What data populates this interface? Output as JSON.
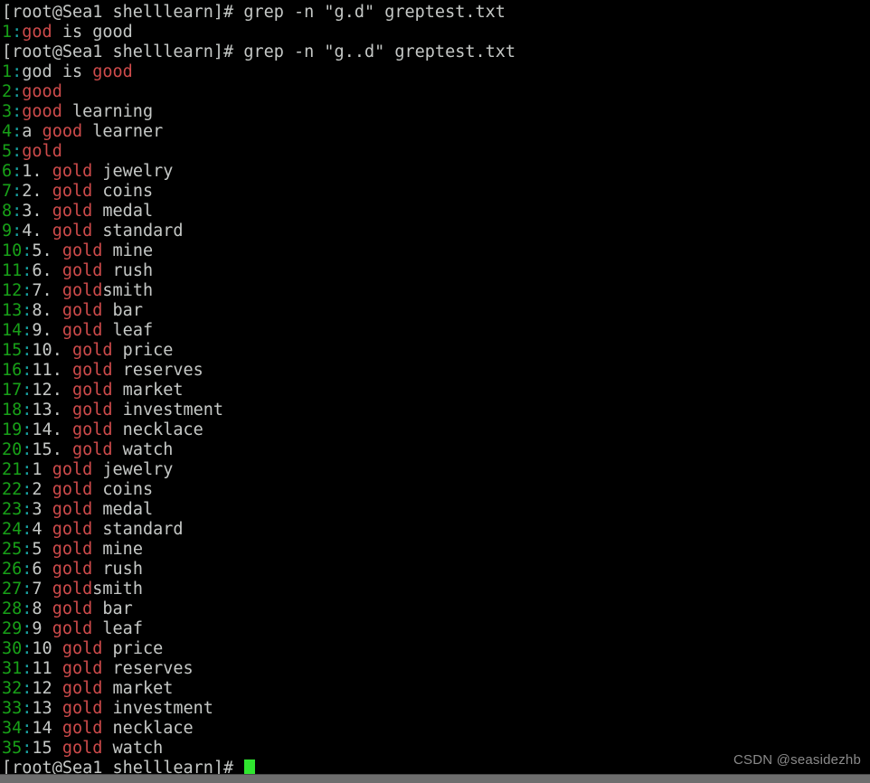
{
  "terminal": {
    "shell_prompt": "[root@Sea1 shelllearn]# ",
    "colors": {
      "background": "#000000",
      "foreground": "#c5c8c6",
      "line_number": "#18a018",
      "separator": "#18a0a0",
      "match": "#cf4b4b",
      "cursor": "#2fe62f",
      "watermark": "#8a8a8a",
      "bottom_bar": "#6e6e6e"
    },
    "commands": [
      {
        "text": "grep -n \"g.d\" greptest.txt"
      },
      {
        "text": "grep -n \"g..d\" greptest.txt"
      }
    ],
    "lines": [
      {
        "type": "command",
        "prompt": "[root@Sea1 shelllearn]# ",
        "command": "grep -n \"g.d\" greptest.txt"
      },
      {
        "type": "result",
        "lineno": "1",
        "sep": ":",
        "parts": [
          {
            "t": "god",
            "m": true
          },
          {
            "t": " is good",
            "m": false
          }
        ]
      },
      {
        "type": "command",
        "prompt": "[root@Sea1 shelllearn]# ",
        "command": "grep -n \"g..d\" greptest.txt"
      },
      {
        "type": "result",
        "lineno": "1",
        "sep": ":",
        "parts": [
          {
            "t": "god is ",
            "m": false
          },
          {
            "t": "good",
            "m": true
          }
        ]
      },
      {
        "type": "result",
        "lineno": "2",
        "sep": ":",
        "parts": [
          {
            "t": "good",
            "m": true
          }
        ]
      },
      {
        "type": "result",
        "lineno": "3",
        "sep": ":",
        "parts": [
          {
            "t": "good",
            "m": true
          },
          {
            "t": " learning",
            "m": false
          }
        ]
      },
      {
        "type": "result",
        "lineno": "4",
        "sep": ":",
        "parts": [
          {
            "t": "a ",
            "m": false
          },
          {
            "t": "good",
            "m": true
          },
          {
            "t": " learner",
            "m": false
          }
        ]
      },
      {
        "type": "result",
        "lineno": "5",
        "sep": ":",
        "parts": [
          {
            "t": "gold",
            "m": true
          }
        ]
      },
      {
        "type": "result",
        "lineno": "6",
        "sep": ":",
        "parts": [
          {
            "t": "1. ",
            "m": false
          },
          {
            "t": "gold",
            "m": true
          },
          {
            "t": " jewelry",
            "m": false
          }
        ]
      },
      {
        "type": "result",
        "lineno": "7",
        "sep": ":",
        "parts": [
          {
            "t": "2. ",
            "m": false
          },
          {
            "t": "gold",
            "m": true
          },
          {
            "t": " coins",
            "m": false
          }
        ]
      },
      {
        "type": "result",
        "lineno": "8",
        "sep": ":",
        "parts": [
          {
            "t": "3. ",
            "m": false
          },
          {
            "t": "gold",
            "m": true
          },
          {
            "t": " medal",
            "m": false
          }
        ]
      },
      {
        "type": "result",
        "lineno": "9",
        "sep": ":",
        "parts": [
          {
            "t": "4. ",
            "m": false
          },
          {
            "t": "gold",
            "m": true
          },
          {
            "t": " standard",
            "m": false
          }
        ]
      },
      {
        "type": "result",
        "lineno": "10",
        "sep": ":",
        "parts": [
          {
            "t": "5. ",
            "m": false
          },
          {
            "t": "gold",
            "m": true
          },
          {
            "t": " mine",
            "m": false
          }
        ]
      },
      {
        "type": "result",
        "lineno": "11",
        "sep": ":",
        "parts": [
          {
            "t": "6. ",
            "m": false
          },
          {
            "t": "gold",
            "m": true
          },
          {
            "t": " rush",
            "m": false
          }
        ]
      },
      {
        "type": "result",
        "lineno": "12",
        "sep": ":",
        "parts": [
          {
            "t": "7. ",
            "m": false
          },
          {
            "t": "gold",
            "m": true
          },
          {
            "t": "smith",
            "m": false
          }
        ]
      },
      {
        "type": "result",
        "lineno": "13",
        "sep": ":",
        "parts": [
          {
            "t": "8. ",
            "m": false
          },
          {
            "t": "gold",
            "m": true
          },
          {
            "t": " bar",
            "m": false
          }
        ]
      },
      {
        "type": "result",
        "lineno": "14",
        "sep": ":",
        "parts": [
          {
            "t": "9. ",
            "m": false
          },
          {
            "t": "gold",
            "m": true
          },
          {
            "t": " leaf",
            "m": false
          }
        ]
      },
      {
        "type": "result",
        "lineno": "15",
        "sep": ":",
        "parts": [
          {
            "t": "10. ",
            "m": false
          },
          {
            "t": "gold",
            "m": true
          },
          {
            "t": " price",
            "m": false
          }
        ]
      },
      {
        "type": "result",
        "lineno": "16",
        "sep": ":",
        "parts": [
          {
            "t": "11. ",
            "m": false
          },
          {
            "t": "gold",
            "m": true
          },
          {
            "t": " reserves",
            "m": false
          }
        ]
      },
      {
        "type": "result",
        "lineno": "17",
        "sep": ":",
        "parts": [
          {
            "t": "12. ",
            "m": false
          },
          {
            "t": "gold",
            "m": true
          },
          {
            "t": " market",
            "m": false
          }
        ]
      },
      {
        "type": "result",
        "lineno": "18",
        "sep": ":",
        "parts": [
          {
            "t": "13. ",
            "m": false
          },
          {
            "t": "gold",
            "m": true
          },
          {
            "t": " investment",
            "m": false
          }
        ]
      },
      {
        "type": "result",
        "lineno": "19",
        "sep": ":",
        "parts": [
          {
            "t": "14. ",
            "m": false
          },
          {
            "t": "gold",
            "m": true
          },
          {
            "t": " necklace",
            "m": false
          }
        ]
      },
      {
        "type": "result",
        "lineno": "20",
        "sep": ":",
        "parts": [
          {
            "t": "15. ",
            "m": false
          },
          {
            "t": "gold",
            "m": true
          },
          {
            "t": " watch",
            "m": false
          }
        ]
      },
      {
        "type": "result",
        "lineno": "21",
        "sep": ":",
        "parts": [
          {
            "t": "1 ",
            "m": false
          },
          {
            "t": "gold",
            "m": true
          },
          {
            "t": " jewelry",
            "m": false
          }
        ]
      },
      {
        "type": "result",
        "lineno": "22",
        "sep": ":",
        "parts": [
          {
            "t": "2 ",
            "m": false
          },
          {
            "t": "gold",
            "m": true
          },
          {
            "t": " coins",
            "m": false
          }
        ]
      },
      {
        "type": "result",
        "lineno": "23",
        "sep": ":",
        "parts": [
          {
            "t": "3 ",
            "m": false
          },
          {
            "t": "gold",
            "m": true
          },
          {
            "t": " medal",
            "m": false
          }
        ]
      },
      {
        "type": "result",
        "lineno": "24",
        "sep": ":",
        "parts": [
          {
            "t": "4 ",
            "m": false
          },
          {
            "t": "gold",
            "m": true
          },
          {
            "t": " standard",
            "m": false
          }
        ]
      },
      {
        "type": "result",
        "lineno": "25",
        "sep": ":",
        "parts": [
          {
            "t": "5 ",
            "m": false
          },
          {
            "t": "gold",
            "m": true
          },
          {
            "t": " mine",
            "m": false
          }
        ]
      },
      {
        "type": "result",
        "lineno": "26",
        "sep": ":",
        "parts": [
          {
            "t": "6 ",
            "m": false
          },
          {
            "t": "gold",
            "m": true
          },
          {
            "t": " rush",
            "m": false
          }
        ]
      },
      {
        "type": "result",
        "lineno": "27",
        "sep": ":",
        "parts": [
          {
            "t": "7 ",
            "m": false
          },
          {
            "t": "gold",
            "m": true
          },
          {
            "t": "smith",
            "m": false
          }
        ]
      },
      {
        "type": "result",
        "lineno": "28",
        "sep": ":",
        "parts": [
          {
            "t": "8 ",
            "m": false
          },
          {
            "t": "gold",
            "m": true
          },
          {
            "t": " bar",
            "m": false
          }
        ]
      },
      {
        "type": "result",
        "lineno": "29",
        "sep": ":",
        "parts": [
          {
            "t": "9 ",
            "m": false
          },
          {
            "t": "gold",
            "m": true
          },
          {
            "t": " leaf",
            "m": false
          }
        ]
      },
      {
        "type": "result",
        "lineno": "30",
        "sep": ":",
        "parts": [
          {
            "t": "10 ",
            "m": false
          },
          {
            "t": "gold",
            "m": true
          },
          {
            "t": " price",
            "m": false
          }
        ]
      },
      {
        "type": "result",
        "lineno": "31",
        "sep": ":",
        "parts": [
          {
            "t": "11 ",
            "m": false
          },
          {
            "t": "gold",
            "m": true
          },
          {
            "t": " reserves",
            "m": false
          }
        ]
      },
      {
        "type": "result",
        "lineno": "32",
        "sep": ":",
        "parts": [
          {
            "t": "12 ",
            "m": false
          },
          {
            "t": "gold",
            "m": true
          },
          {
            "t": " market",
            "m": false
          }
        ]
      },
      {
        "type": "result",
        "lineno": "33",
        "sep": ":",
        "parts": [
          {
            "t": "13 ",
            "m": false
          },
          {
            "t": "gold",
            "m": true
          },
          {
            "t": " investment",
            "m": false
          }
        ]
      },
      {
        "type": "result",
        "lineno": "34",
        "sep": ":",
        "parts": [
          {
            "t": "14 ",
            "m": false
          },
          {
            "t": "gold",
            "m": true
          },
          {
            "t": " necklace",
            "m": false
          }
        ]
      },
      {
        "type": "result",
        "lineno": "35",
        "sep": ":",
        "parts": [
          {
            "t": "15 ",
            "m": false
          },
          {
            "t": "gold",
            "m": true
          },
          {
            "t": " watch",
            "m": false
          }
        ]
      },
      {
        "type": "prompt",
        "prompt": "[root@Sea1 shelllearn]# ",
        "cursor": true
      }
    ]
  },
  "watermark": {
    "text": "CSDN @seasidezhb"
  }
}
